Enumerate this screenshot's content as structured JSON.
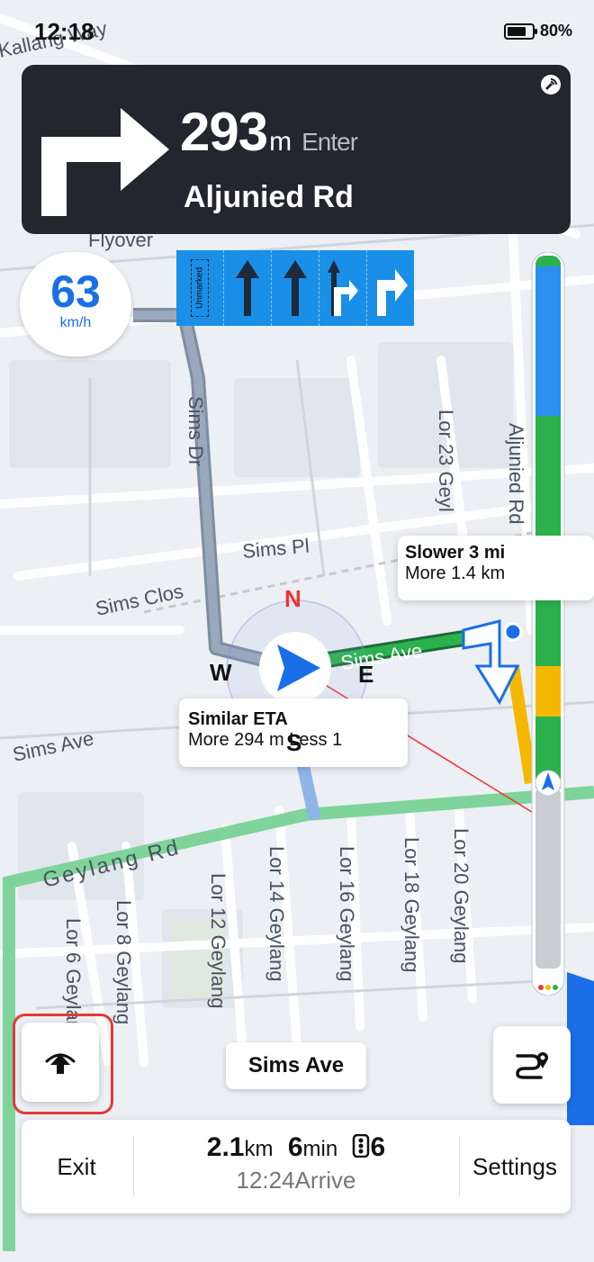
{
  "status_bar": {
    "time": "12:18",
    "battery": "80%"
  },
  "guidance": {
    "distance": "293",
    "unit": "m",
    "action": "Enter",
    "road": "Aljunied Rd"
  },
  "speed": {
    "value": "63",
    "unit": "km/h"
  },
  "lanes": {
    "unmarked_label": "Unmarked"
  },
  "map_labels": {
    "sims_dr": "Sims Dr",
    "sims_pl": "Sims Pl",
    "sims_clos": "Sims Clos",
    "sims_ave_left": "Sims Ave",
    "sims_ave_right": "Sims Ave",
    "geylang_rd": "Geylang Rd",
    "lor6": "Lor 6 Geylang",
    "lor8": "Lor 8 Geylang",
    "lor12": "Lor 12 Geylang",
    "lor14": "Lor 14 Geylang",
    "lor16": "Lor 16 Geylang",
    "lor18": "Lor 18 Geylang",
    "lor20": "Lor 20 Geylang",
    "lor23": "Lor 23 Geyl",
    "aljunied_rd_map": "Aljunied Rd",
    "flyover": "Flyover",
    "kallang_way": "Kallang Way"
  },
  "compass": {
    "n": "N",
    "s": "S",
    "e": "E",
    "w": "W"
  },
  "route_bubbles": {
    "current": {
      "title": "Similar ETA",
      "subtitle": "More 294 m  Less 1"
    },
    "alternative": {
      "title": "Slower 3 mi",
      "subtitle": "More 1.4 km"
    }
  },
  "current_street": "Sims Ave",
  "trip": {
    "exit_label": "Exit",
    "distance": "2.1",
    "distance_unit": "km",
    "duration": "6",
    "duration_unit": "min",
    "traffic_lights": "6",
    "arrive": "12:24Arrive",
    "settings_label": "Settings"
  },
  "colors": {
    "route_green": "#2bb24c",
    "traffic_blue": "#2b8ff0",
    "traffic_yellow": "#f5b800",
    "nav_card_bg": "#24262e",
    "highlight_red": "#e53935"
  }
}
